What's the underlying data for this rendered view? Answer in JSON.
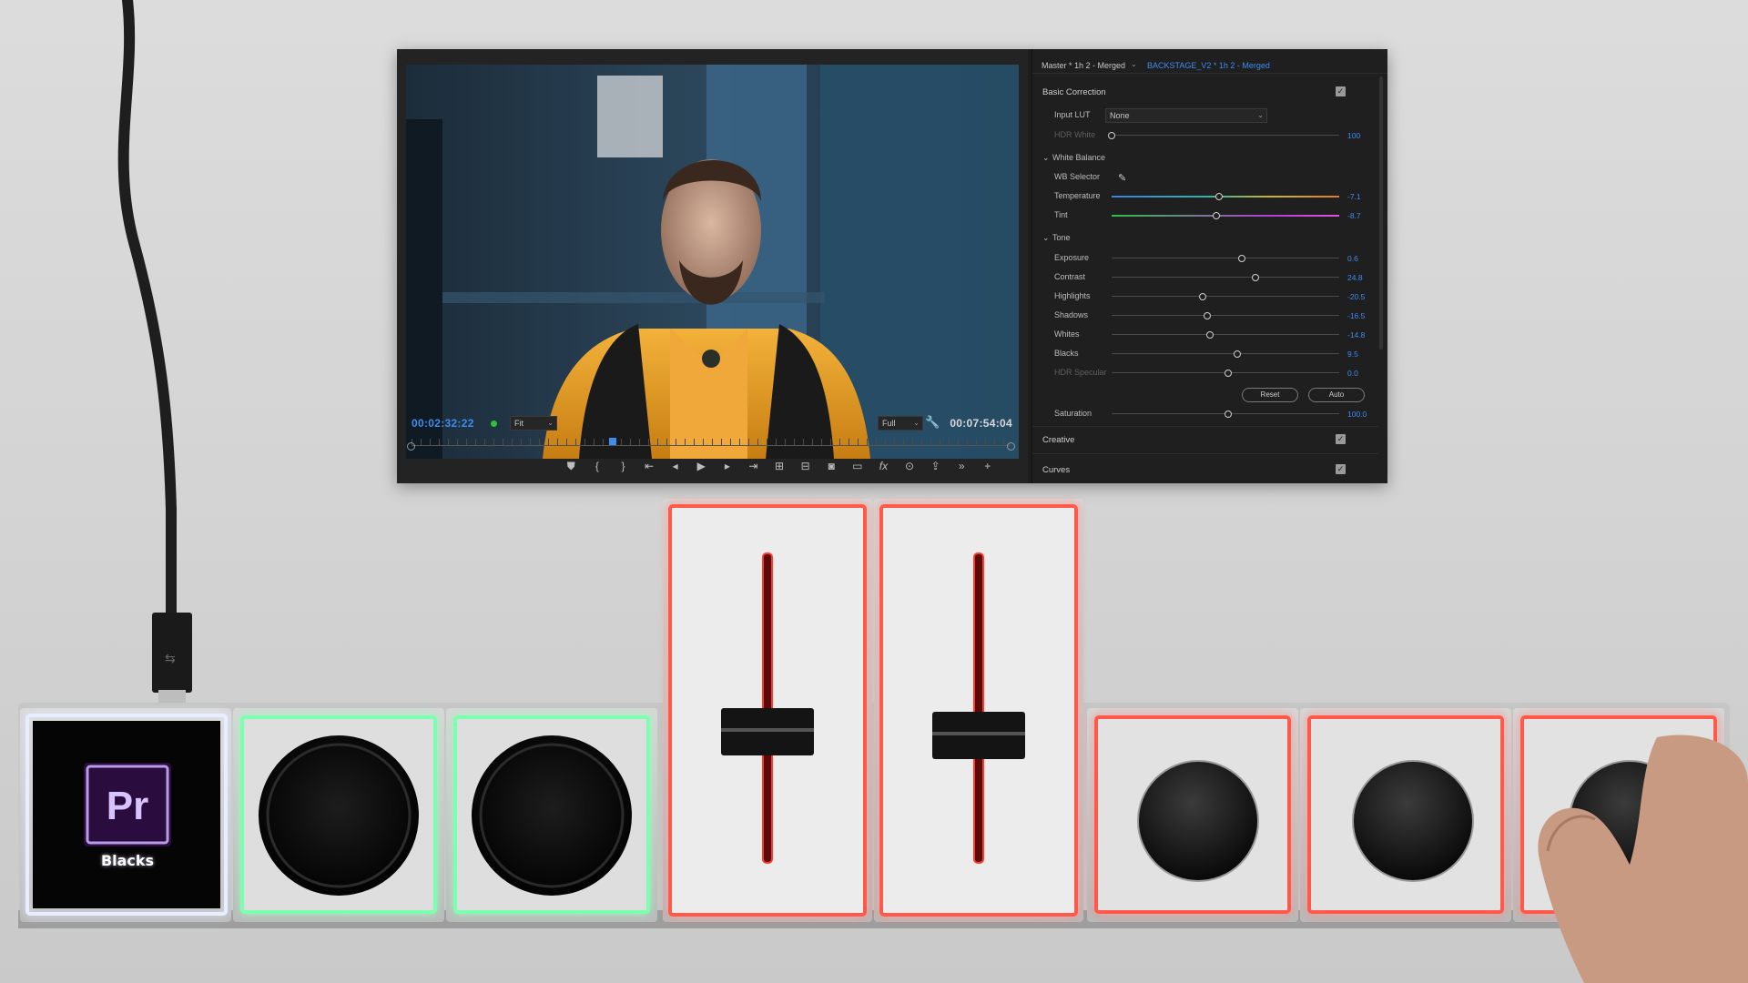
{
  "monitor": {
    "timecode_in": "00:02:32:22",
    "fit_label": "Fit",
    "quality_label": "Full",
    "timecode_out": "00:07:54:04",
    "transport_icons": [
      "add-marker-icon",
      "mark-in-icon",
      "mark-out-icon",
      "go-to-in-icon",
      "step-back-icon",
      "play-icon",
      "step-forward-icon",
      "go-to-out-icon",
      "insert-icon",
      "overwrite-icon",
      "export-frame-icon",
      "safe-margins-icon",
      "fx-icon",
      "vr-icon",
      "lift-icon",
      "more-icon",
      "add-button-icon"
    ]
  },
  "lumetri": {
    "sequence_tab": "Master * 1h 2 - Merged",
    "clip_tab": "BACKSTAGE_V2 * 1h 2 - Merged",
    "basic_correction": "Basic Correction",
    "input_lut_label": "Input LUT",
    "input_lut_value": "None",
    "hdr_white_label": "HDR White",
    "hdr_white_value": "100",
    "white_balance": "White Balance",
    "wb_selector": "WB Selector",
    "temperature_label": "Temperature",
    "temperature_value": "-7.1",
    "tint_label": "Tint",
    "tint_value": "-8.7",
    "tone": "Tone",
    "exposure_label": "Exposure",
    "exposure_value": "0.6",
    "contrast_label": "Contrast",
    "contrast_value": "24.8",
    "highlights_label": "Highlights",
    "highlights_value": "-20.5",
    "shadows_label": "Shadows",
    "shadows_value": "-16.5",
    "whites_label": "Whites",
    "whites_value": "-14.8",
    "blacks_label": "Blacks",
    "blacks_value": "9.5",
    "hdr_specular_label": "HDR Specular",
    "hdr_specular_value": "0.0",
    "reset_label": "Reset",
    "auto_label": "Auto",
    "saturation_label": "Saturation",
    "saturation_value": "100.0",
    "creative": "Creative",
    "curves": "Curves"
  },
  "hardware": {
    "pr_logo": "Pr",
    "pr_caption": "Blacks",
    "colors": {
      "white_glow": "#e8eeff",
      "green_glow": "#7dffb0",
      "red_glow": "#ff5a4a"
    }
  }
}
